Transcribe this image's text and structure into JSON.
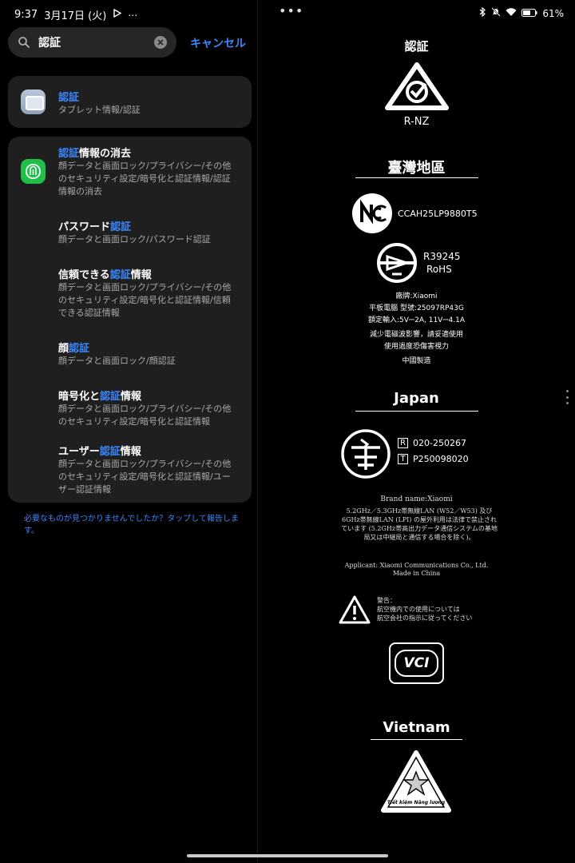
{
  "status_bar": {
    "time": "9:37",
    "date": "3月17日 (火)",
    "menu_dots": "•••",
    "battery": "61%"
  },
  "search": {
    "value": "認証",
    "cancel_label": "キャンセル"
  },
  "results": [
    {
      "title_pre": "",
      "title_hl": "認証",
      "title_post": "",
      "subtitle": "タブレット情報/認証"
    },
    {
      "title_pre": "",
      "title_hl": "認証",
      "title_post": "情報の消去",
      "subtitle": "顔データと画面ロック/プライバシー/その他のセキュリティ設定/暗号化と認証情報/認証情報の消去"
    },
    {
      "title_pre": "パスワード",
      "title_hl": "認証",
      "title_post": "",
      "subtitle": "顔データと画面ロック/パスワード認証"
    },
    {
      "title_pre": "信頼できる",
      "title_hl": "認証",
      "title_post": "情報",
      "subtitle": "顔データと画面ロック/プライバシー/その他のセキュリティ設定/暗号化と認証情報/信頼できる認証情報"
    },
    {
      "title_pre": "顔",
      "title_hl": "認証",
      "title_post": "",
      "subtitle": "顔データと画面ロック/顔認証"
    },
    {
      "title_pre": "暗号化と",
      "title_hl": "認証",
      "title_post": "情報",
      "subtitle": "顔データと画面ロック/プライバシー/その他のセキュリティ設定/暗号化と認証情報"
    },
    {
      "title_pre": "ユーザー",
      "title_hl": "認証",
      "title_post": "情報",
      "subtitle": "顔データと画面ロック/プライバシー/その他のセキュリティ設定/暗号化と認証情報/ユーザー認証情報"
    }
  ],
  "feedback_text": "必要なものが見つかりませんでしたか？タップして報告します。",
  "cert": {
    "title": "認証",
    "rcm_label": "R-NZ",
    "taiwan": {
      "heading": "臺灣地區",
      "ncc_id": "CCAH25LP9880T5",
      "bsmi_id": "R39245",
      "rohs": "RoHS",
      "lines": [
        "廠牌:Xiaomi",
        "平板電腦 型號:25097RP43G",
        "額定輸入:5V⎓2A, 11V⎓4.1A",
        "減少電磁波影響，請妥適使用",
        "使用過度恐傷害視力",
        "中國製造"
      ]
    },
    "japan": {
      "heading": "Japan",
      "r_badge": "R",
      "r_id": "020-250267",
      "t_badge": "T",
      "t_id": "P250098020",
      "brand": "Brand name:Xiaomi",
      "wlan": "5.2GHz／5.3GHz帯無線LAN (W52／W53) 及び6GHz帯無線LAN (LPI) の屋外利用は法律で禁止されています (5.2GHz帯高出力データ通信システムの基地局又は中継局と通信する場合を除く)。",
      "applicant": "Applicant: Xiaomi Communications Co., Ltd.",
      "made": "Made in China",
      "warning_title": "警告：",
      "warning_lines": [
        "航空機内での使用については",
        "航空会社の指示に従ってください"
      ],
      "vcci": "VCI"
    },
    "vietnam": {
      "heading": "Vietnam",
      "label_text": "Tiết kiệm Năng lượng"
    }
  }
}
